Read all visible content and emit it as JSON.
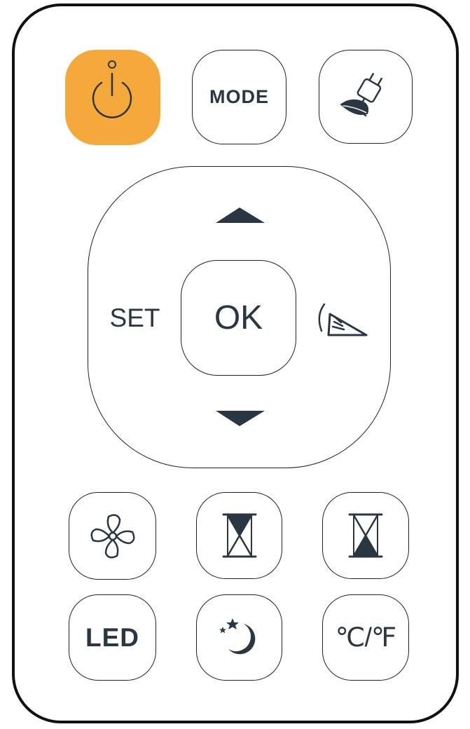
{
  "remote": {
    "accent_color": "#F6A93B",
    "ink_color": "#2A3642",
    "buttons": {
      "power": {
        "icon": "power-icon"
      },
      "mode": {
        "label": "MODE"
      },
      "eco": {
        "icon": "eco-plug-leaf-icon"
      },
      "up": {
        "icon": "triangle-up-icon"
      },
      "down": {
        "icon": "triangle-down-icon"
      },
      "set": {
        "label": "SET"
      },
      "ok": {
        "label": "OK"
      },
      "swing": {
        "icon": "swing-icon"
      },
      "fan": {
        "icon": "fan-icon"
      },
      "timer_on": {
        "icon": "hourglass-top-icon"
      },
      "timer_off": {
        "icon": "hourglass-bottom-icon"
      },
      "led": {
        "label": "LED"
      },
      "sleep": {
        "icon": "moon-stars-icon"
      },
      "unit": {
        "label": "℃/℉"
      }
    }
  }
}
